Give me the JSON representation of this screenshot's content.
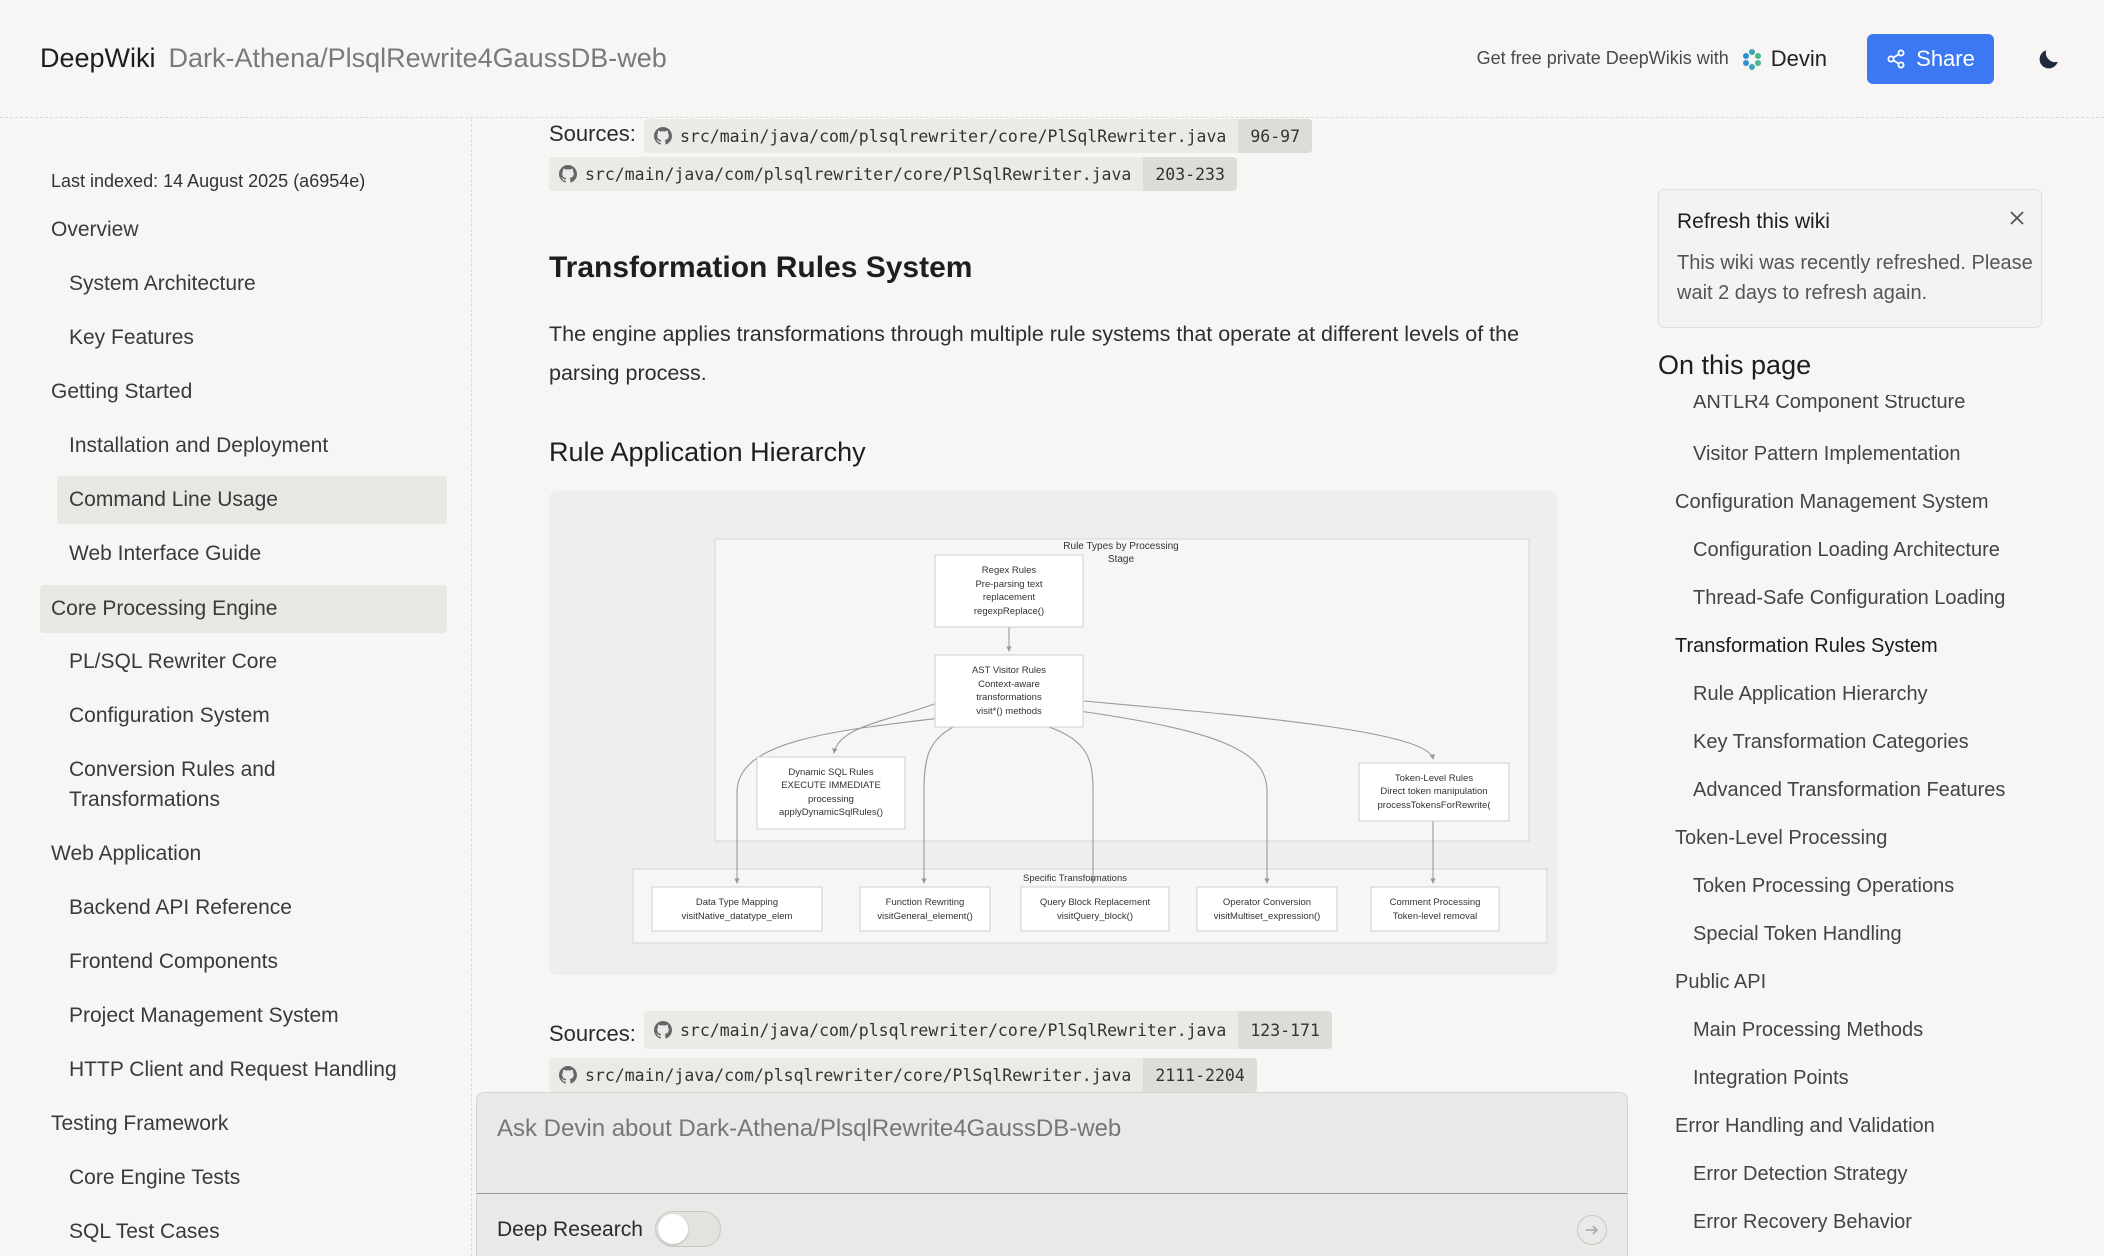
{
  "header": {
    "brand": "DeepWiki",
    "repo": "Dark-Athena/PlsqlRewrite4GaussDB-web",
    "promo": "Get free private DeepWikis with",
    "devin_label": "Devin",
    "share_label": "Share"
  },
  "sidebar": {
    "last_indexed": "Last indexed: 14 August 2025 (a6954e)",
    "items": [
      {
        "label": "Overview"
      },
      {
        "label": "System Architecture"
      },
      {
        "label": "Key Features"
      },
      {
        "label": "Getting Started"
      },
      {
        "label": "Installation and Deployment"
      },
      {
        "label": "Command Line Usage"
      },
      {
        "label": "Web Interface Guide"
      },
      {
        "label": "Core Processing Engine"
      },
      {
        "label": "PL/SQL Rewriter Core"
      },
      {
        "label": "Configuration System"
      },
      {
        "label": "Conversion Rules and"
      },
      {
        "label": "Transformations"
      },
      {
        "label": "Web Application"
      },
      {
        "label": "Backend API Reference"
      },
      {
        "label": "Frontend Components"
      },
      {
        "label": "Project Management System"
      },
      {
        "label": "HTTP Client and Request Handling"
      },
      {
        "label": "Testing Framework"
      },
      {
        "label": "Core Engine Tests"
      },
      {
        "label": "SQL Test Cases"
      }
    ]
  },
  "main": {
    "sources_label": "Sources:",
    "top_sources": [
      {
        "path": "src/main/java/com/plsqlrewriter/core/PlSqlRewriter.java",
        "lines": "96-97"
      },
      {
        "path": "src/main/java/com/plsqlrewriter/core/PlSqlRewriter.java",
        "lines": "203-233"
      }
    ],
    "section_title": "Transformation Rules System",
    "section_para": "The engine applies transformations through multiple rule systems that operate at different levels of the parsing process.",
    "subsection_title": "Rule Application Hierarchy",
    "bottom_sources": [
      {
        "path": "src/main/java/com/plsqlrewriter/core/PlSqlRewriter.java",
        "lines": "123-171"
      },
      {
        "path": "src/main/java/com/plsqlrewriter/core/PlSqlRewriter.java",
        "lines": "2111-2204"
      }
    ],
    "diagram": {
      "group_title_1": "Rule Types by Processing",
      "group_title_2": "Stage",
      "regex": [
        "Regex Rules",
        "Pre-parsing text",
        "replacement",
        "regexpReplace()"
      ],
      "ast": [
        "AST Visitor Rules",
        "Context-aware",
        "transformations",
        "visit*() methods"
      ],
      "dynamic": [
        "Dynamic SQL Rules",
        "EXECUTE IMMEDIATE",
        "processing",
        "applyDynamicSqlRules()"
      ],
      "token": [
        "Token-Level Rules",
        "Direct token manipulation",
        "processTokensForRewrite("
      ],
      "specific_title": "Specific Transformations",
      "specific": [
        [
          "Data Type Mapping",
          "visitNative_datatype_elem"
        ],
        [
          "Function Rewriting",
          "visitGeneral_element()"
        ],
        [
          "Query Block Replacement",
          "visitQuery_block()"
        ],
        [
          "Operator Conversion",
          "visitMultiset_expression()"
        ],
        [
          "Comment Processing",
          "Token-level removal"
        ]
      ]
    }
  },
  "refresh": {
    "title": "Refresh this wiki",
    "body": "This wiki was recently refreshed. Please wait 2 days to refresh again."
  },
  "toc": {
    "title": "On this page",
    "items": [
      {
        "label": "ANTLR4 Component Structure"
      },
      {
        "label": "Visitor Pattern Implementation"
      },
      {
        "label": "Configuration Management System"
      },
      {
        "label": "Configuration Loading Architecture"
      },
      {
        "label": "Thread-Safe Configuration Loading"
      },
      {
        "label": "Transformation Rules System"
      },
      {
        "label": "Rule Application Hierarchy"
      },
      {
        "label": "Key Transformation Categories"
      },
      {
        "label": "Advanced Transformation Features"
      },
      {
        "label": "Token-Level Processing"
      },
      {
        "label": "Token Processing Operations"
      },
      {
        "label": "Special Token Handling"
      },
      {
        "label": "Public API"
      },
      {
        "label": "Main Processing Methods"
      },
      {
        "label": "Integration Points"
      },
      {
        "label": "Error Handling and Validation"
      },
      {
        "label": "Error Detection Strategy"
      },
      {
        "label": "Error Recovery Behavior"
      }
    ]
  },
  "askbar": {
    "placeholder": "Ask Devin about Dark-Athena/PlsqlRewrite4GaussDB-web",
    "deep_research_label": "Deep Research",
    "deep_research_on": false
  }
}
